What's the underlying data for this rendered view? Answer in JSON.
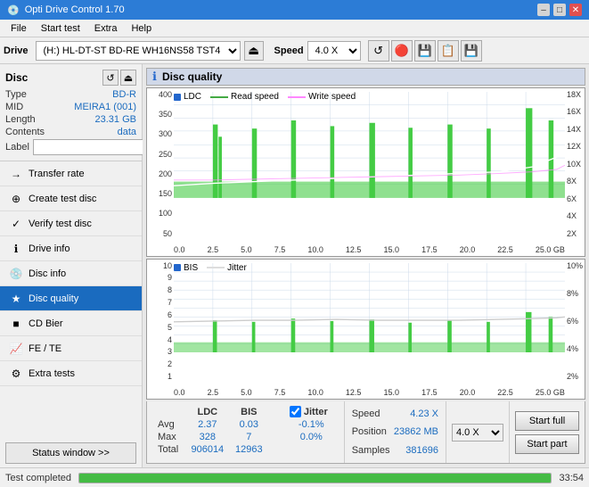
{
  "titlebar": {
    "title": "Opti Drive Control 1.70",
    "minimize": "–",
    "maximize": "□",
    "close": "✕"
  },
  "menu": {
    "items": [
      "File",
      "Start test",
      "Extra",
      "Help"
    ]
  },
  "drive": {
    "label": "Drive",
    "drive_name": "(H:)  HL-DT-ST BD-RE  WH16NS58 TST4",
    "speed_label": "Speed",
    "speed_value": "4.0 X"
  },
  "disc": {
    "title": "Disc",
    "type_label": "Type",
    "type_value": "BD-R",
    "mid_label": "MID",
    "mid_value": "MEIRA1 (001)",
    "length_label": "Length",
    "length_value": "23.31 GB",
    "contents_label": "Contents",
    "contents_value": "data",
    "label_label": "Label"
  },
  "nav": {
    "items": [
      {
        "label": "Transfer rate",
        "icon": "→"
      },
      {
        "label": "Create test disc",
        "icon": "⊕"
      },
      {
        "label": "Verify test disc",
        "icon": "✓"
      },
      {
        "label": "Drive info",
        "icon": "ℹ"
      },
      {
        "label": "Disc info",
        "icon": "💿"
      },
      {
        "label": "Disc quality",
        "icon": "★",
        "active": true
      },
      {
        "label": "CD Bier",
        "icon": "🍺"
      },
      {
        "label": "FE / TE",
        "icon": "📈"
      },
      {
        "label": "Extra tests",
        "icon": "⚙"
      }
    ],
    "status_window": "Status window >>"
  },
  "disc_quality": {
    "title": "Disc quality",
    "legend": {
      "ldc": "LDC",
      "read_speed": "Read speed",
      "write_speed": "Write speed",
      "bis": "BIS",
      "jitter": "Jitter"
    }
  },
  "chart_top": {
    "y_labels": [
      "400",
      "350",
      "300",
      "250",
      "200",
      "150",
      "100",
      "50"
    ],
    "y_labels_right": [
      "18X",
      "16X",
      "14X",
      "12X",
      "10X",
      "8X",
      "6X",
      "4X",
      "2X"
    ],
    "x_labels": [
      "0.0",
      "2.5",
      "5.0",
      "7.5",
      "10.0",
      "12.5",
      "15.0",
      "17.5",
      "20.0",
      "22.5",
      "25.0 GB"
    ]
  },
  "chart_bottom": {
    "y_labels": [
      "10",
      "9",
      "8",
      "7",
      "6",
      "5",
      "4",
      "3",
      "2",
      "1"
    ],
    "y_labels_right": [
      "10%",
      "8%",
      "6%",
      "4%",
      "2%"
    ],
    "x_labels": [
      "0.0",
      "2.5",
      "5.0",
      "7.5",
      "10.0",
      "12.5",
      "15.0",
      "17.5",
      "20.0",
      "22.5",
      "25.0 GB"
    ]
  },
  "stats": {
    "headers": [
      "",
      "LDC",
      "BIS",
      "",
      "Jitter",
      "Speed"
    ],
    "avg_label": "Avg",
    "avg_ldc": "2.37",
    "avg_bis": "0.03",
    "avg_jitter": "-0.1%",
    "max_label": "Max",
    "max_ldc": "328",
    "max_bis": "7",
    "max_jitter": "0.0%",
    "total_label": "Total",
    "total_ldc": "906014",
    "total_bis": "12963",
    "jitter_checked": true,
    "speed_label": "Speed",
    "speed_value": "4.23 X",
    "speed_select": "4.0 X",
    "position_label": "Position",
    "position_value": "23862 MB",
    "samples_label": "Samples",
    "samples_value": "381696",
    "start_full": "Start full",
    "start_part": "Start part"
  },
  "statusbar": {
    "text": "Test completed",
    "progress": 100,
    "time": "33:54"
  }
}
